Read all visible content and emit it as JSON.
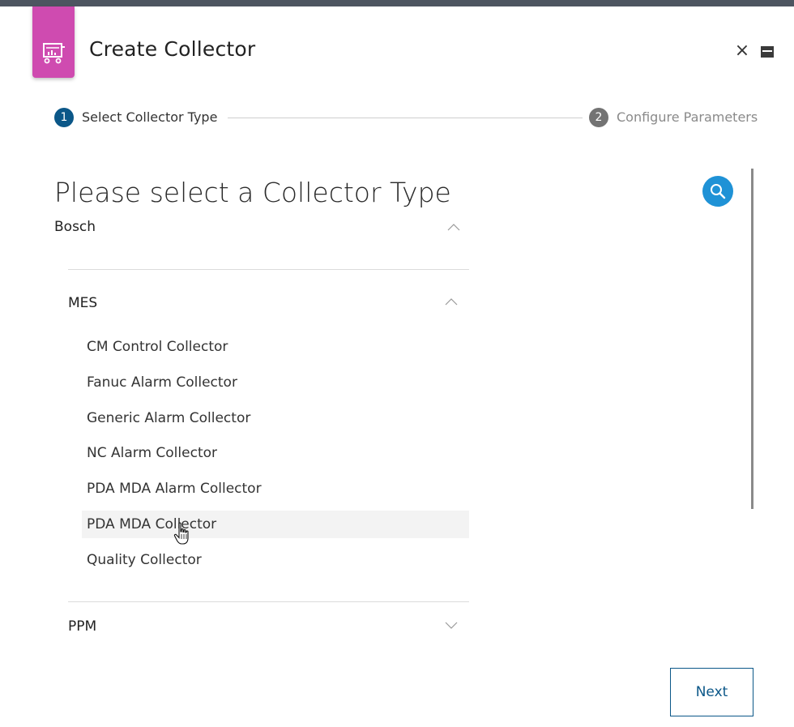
{
  "dialog": {
    "title": "Create Collector",
    "close_label": "×",
    "icons": {
      "app": "collector-cart-icon",
      "close": "close-icon",
      "minimize": "minimize-icon"
    },
    "colors": {
      "accent": "#cf4bb0",
      "primary": "#0b5788",
      "search": "#1f92d6"
    }
  },
  "stepper": {
    "steps": [
      {
        "number": "1",
        "label": "Select Collector Type",
        "active": true
      },
      {
        "number": "2",
        "label": "Configure Parameters",
        "active": false
      }
    ]
  },
  "content": {
    "heading": "Please select a Collector Type",
    "search_icon": "search-icon",
    "groups": [
      {
        "label": "Bosch",
        "expanded": true,
        "subgroups": [
          {
            "label": "MES",
            "expanded": true,
            "items": [
              "CM Control Collector",
              "Fanuc Alarm Collector",
              "Generic Alarm Collector",
              "NC Alarm Collector",
              "PDA MDA Alarm Collector",
              "PDA MDA Collector",
              "Quality Collector"
            ],
            "hovered_item": "PDA MDA Collector"
          },
          {
            "label": "PPM",
            "expanded": false
          }
        ]
      }
    ]
  },
  "footer": {
    "next_label": "Next"
  }
}
